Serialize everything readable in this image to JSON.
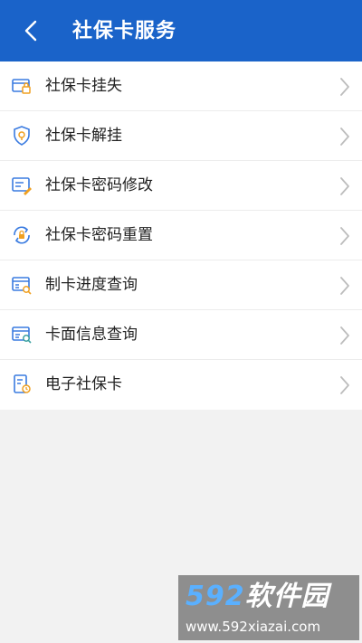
{
  "header": {
    "title": "社保卡服务",
    "back_icon": "chevron-left-icon",
    "background": "#1a63c9"
  },
  "menu": {
    "items": [
      {
        "label": "社保卡挂失",
        "icon": "card-lock-icon"
      },
      {
        "label": "社保卡解挂",
        "icon": "shield-unlock-icon"
      },
      {
        "label": "社保卡密码修改",
        "icon": "card-edit-icon"
      },
      {
        "label": "社保卡密码重置",
        "icon": "lock-reset-icon"
      },
      {
        "label": "制卡进度查询",
        "icon": "card-progress-icon"
      },
      {
        "label": "卡面信息查询",
        "icon": "card-search-icon"
      },
      {
        "label": "电子社保卡",
        "icon": "ecard-icon"
      }
    ],
    "accent_blue": "#3a7be0",
    "accent_orange": "#f0a020"
  },
  "watermark": {
    "brand_number": "592",
    "brand_text": "软件园",
    "url": "www.592xiazai.com"
  }
}
